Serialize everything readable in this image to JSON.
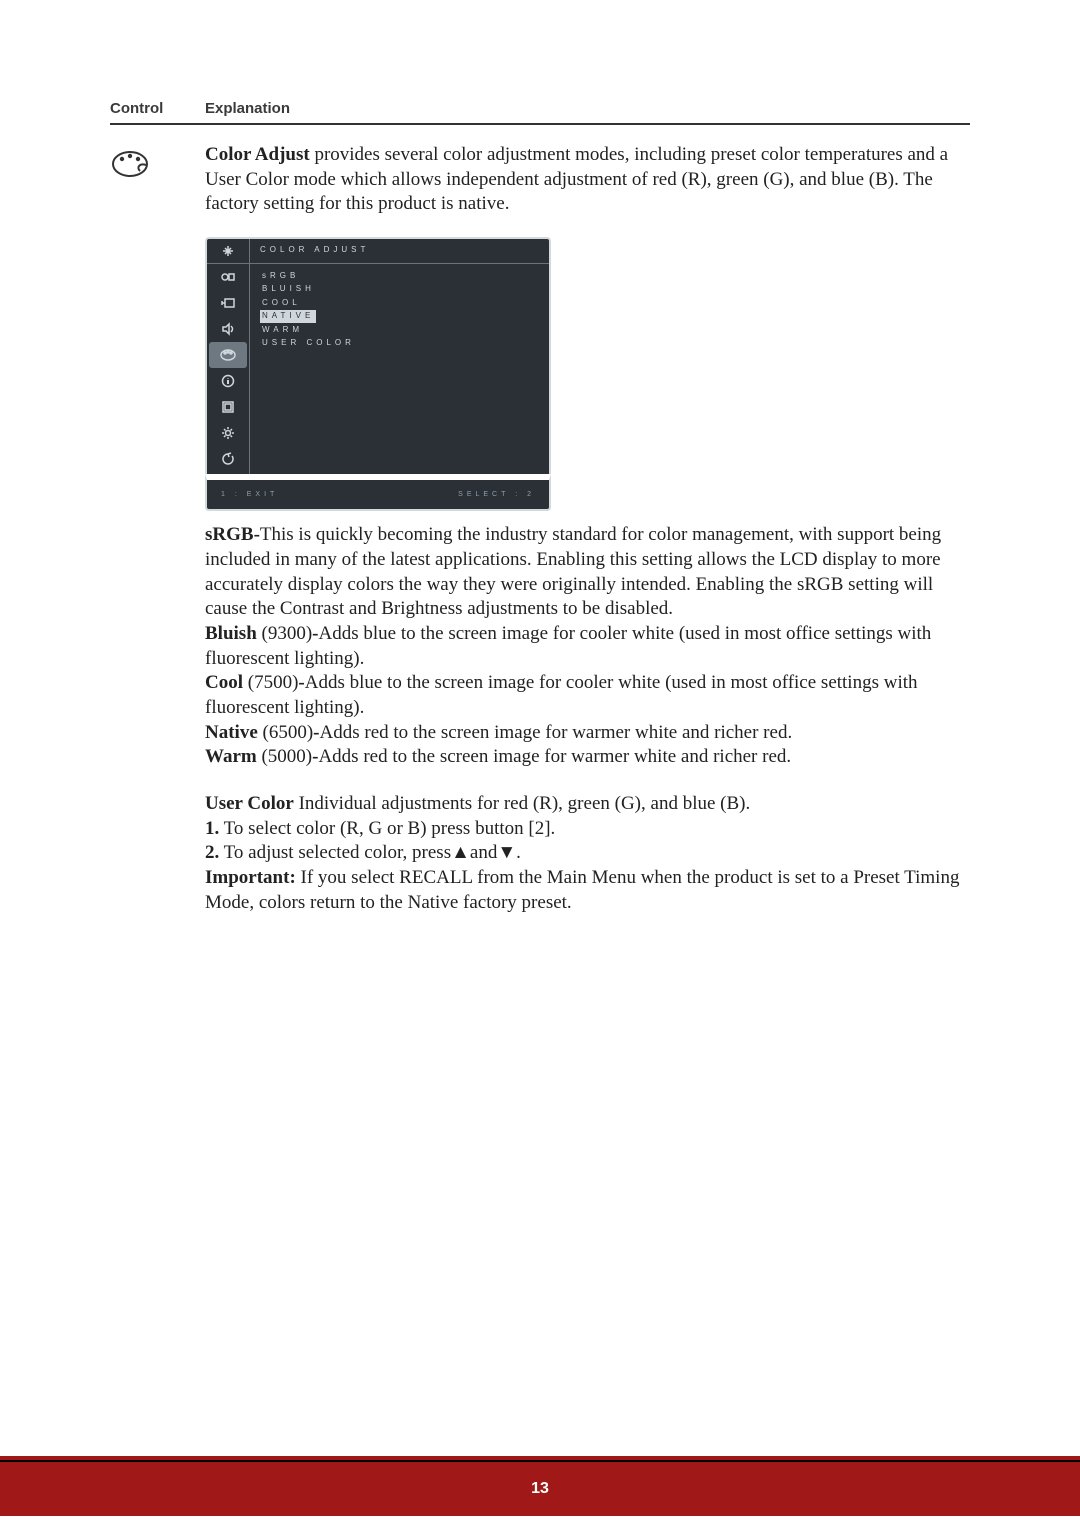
{
  "header": {
    "control_label": "Control",
    "explanation_label": "Explanation"
  },
  "intro": {
    "title": "Color Adjust",
    "text": " provides several color adjustment modes, including preset color temperatures and a User Color mode which allows independent adjustment of red (R), green (G), and blue (B). The factory setting for this product is native."
  },
  "osd": {
    "title": "COLOR ADJUST",
    "menu_items": [
      "sRGB",
      "BLUISH",
      "COOL",
      "NATIVE",
      "WARM",
      "USER COLOR"
    ],
    "selected_index": 3,
    "footer_left": "1 : EXIT",
    "footer_right": "SELECT : 2"
  },
  "srgb": {
    "title": "sRGB-",
    "text": "This is quickly becoming the industry standard for color management, with support being included in many of the latest applications. Enabling this setting allows the LCD display to more accurately display colors the way they were originally intended. Enabling the sRGB setting will cause the Contrast and Brightness adjustments to be disabled."
  },
  "bluish": {
    "title": "Bluish",
    "value": " (9300)",
    "sep": "-",
    "text": "Adds blue to the screen image for cooler white (used in most office settings with fluorescent lighting)."
  },
  "cool": {
    "title": "Cool",
    "value": " (7500)",
    "sep": "-",
    "text": "Adds blue to the screen image for cooler white (used in most office settings with fluorescent lighting)."
  },
  "native": {
    "title": "Native",
    "value": " (6500)",
    "sep": "-",
    "text": "Adds red to the screen image for warmer white and richer red."
  },
  "warm": {
    "title": "Warm",
    "value": " (5000)",
    "sep": "-",
    "text": "Adds red to the screen image for warmer white and richer red."
  },
  "user_color": {
    "title": "User Color",
    "intro": "  Individual adjustments for red (R), green (G),  and blue (B).",
    "step1_num": "1.",
    "step1": "  To select color (R, G or B) press button [2].",
    "step2_num": "2.",
    "step2a": "  To adjust selected color, press",
    "step2b": "and",
    "step2c": ".",
    "important_label": "Important:",
    "important_text": " If you select RECALL from the Main Menu when the product is set to a Preset Timing Mode, colors return to the Native factory preset."
  },
  "page_number": "13"
}
